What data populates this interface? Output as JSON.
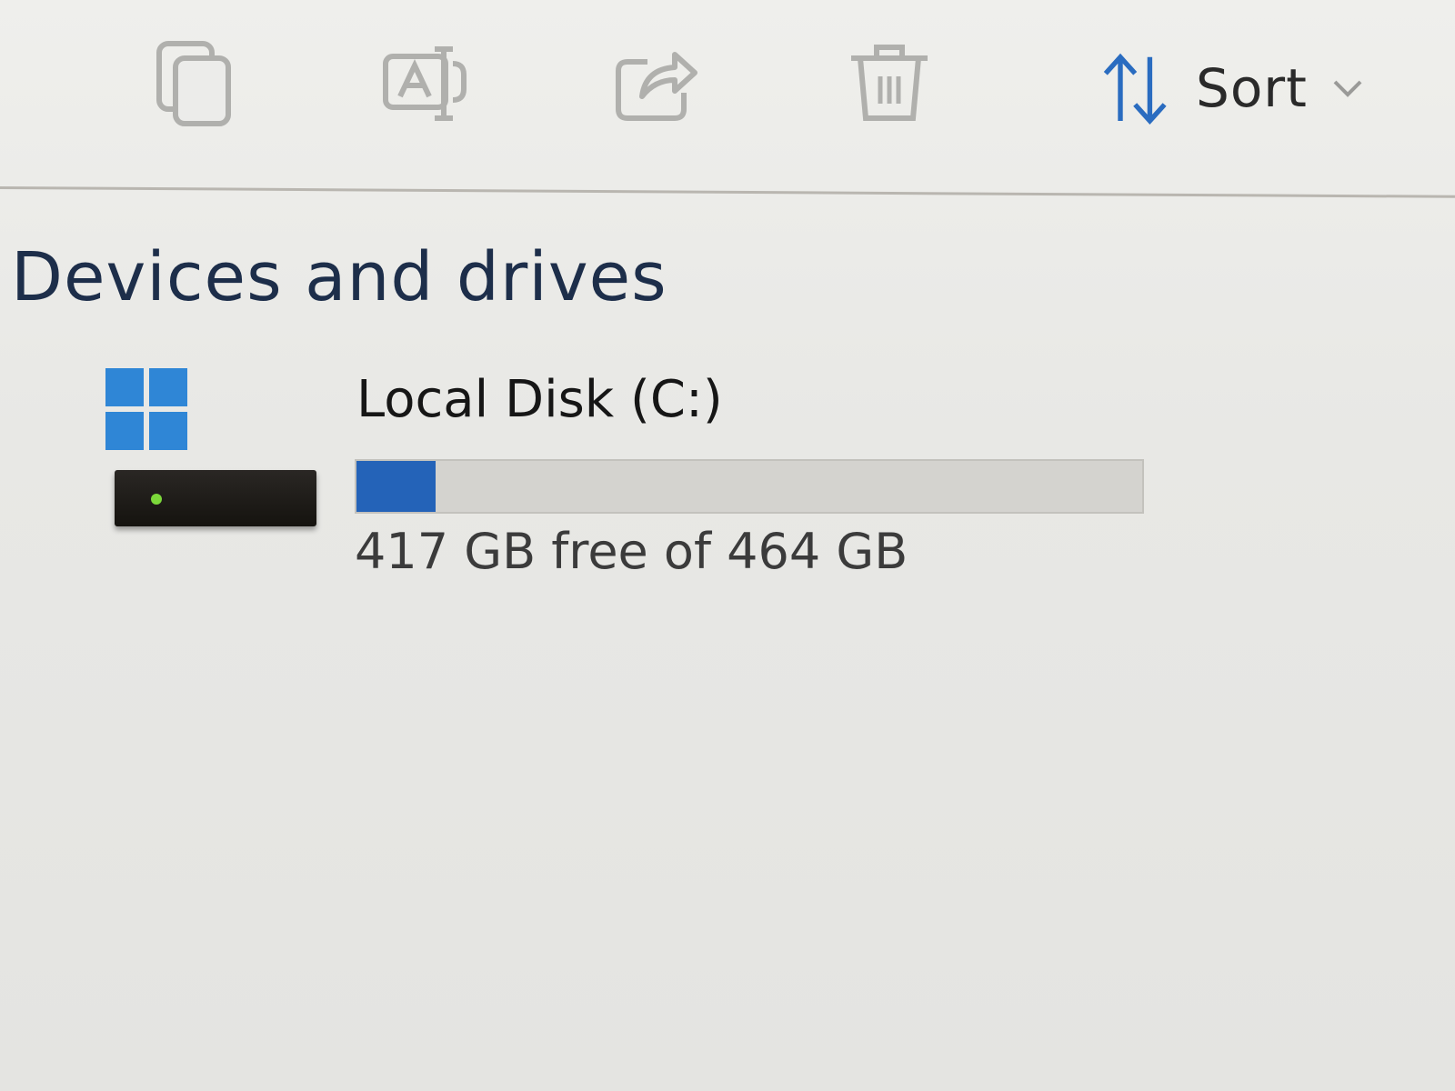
{
  "toolbar": {
    "buttons": [
      {
        "name": "copy-button",
        "icon": "copy-icon"
      },
      {
        "name": "rename-button",
        "icon": "rename-icon"
      },
      {
        "name": "share-button",
        "icon": "share-icon"
      },
      {
        "name": "delete-button",
        "icon": "trash-icon"
      }
    ],
    "sort": {
      "icon": "sort-arrows-icon",
      "label": "Sort",
      "chevron": "chevron-down-icon"
    }
  },
  "section": {
    "title": "Devices and drives"
  },
  "drives": [
    {
      "icon": "windows-drive-icon",
      "name": "Local Disk (C:)",
      "space_text": "417 GB free of 464 GB",
      "free_gb": 417,
      "total_gb": 464,
      "used_fraction": 0.101,
      "bar_color": "#2463b8"
    }
  ],
  "colors": {
    "accent": "#2f86d6",
    "disabled_icon": "#a9a9a9",
    "sort_arrow": "#2a6cc0"
  }
}
